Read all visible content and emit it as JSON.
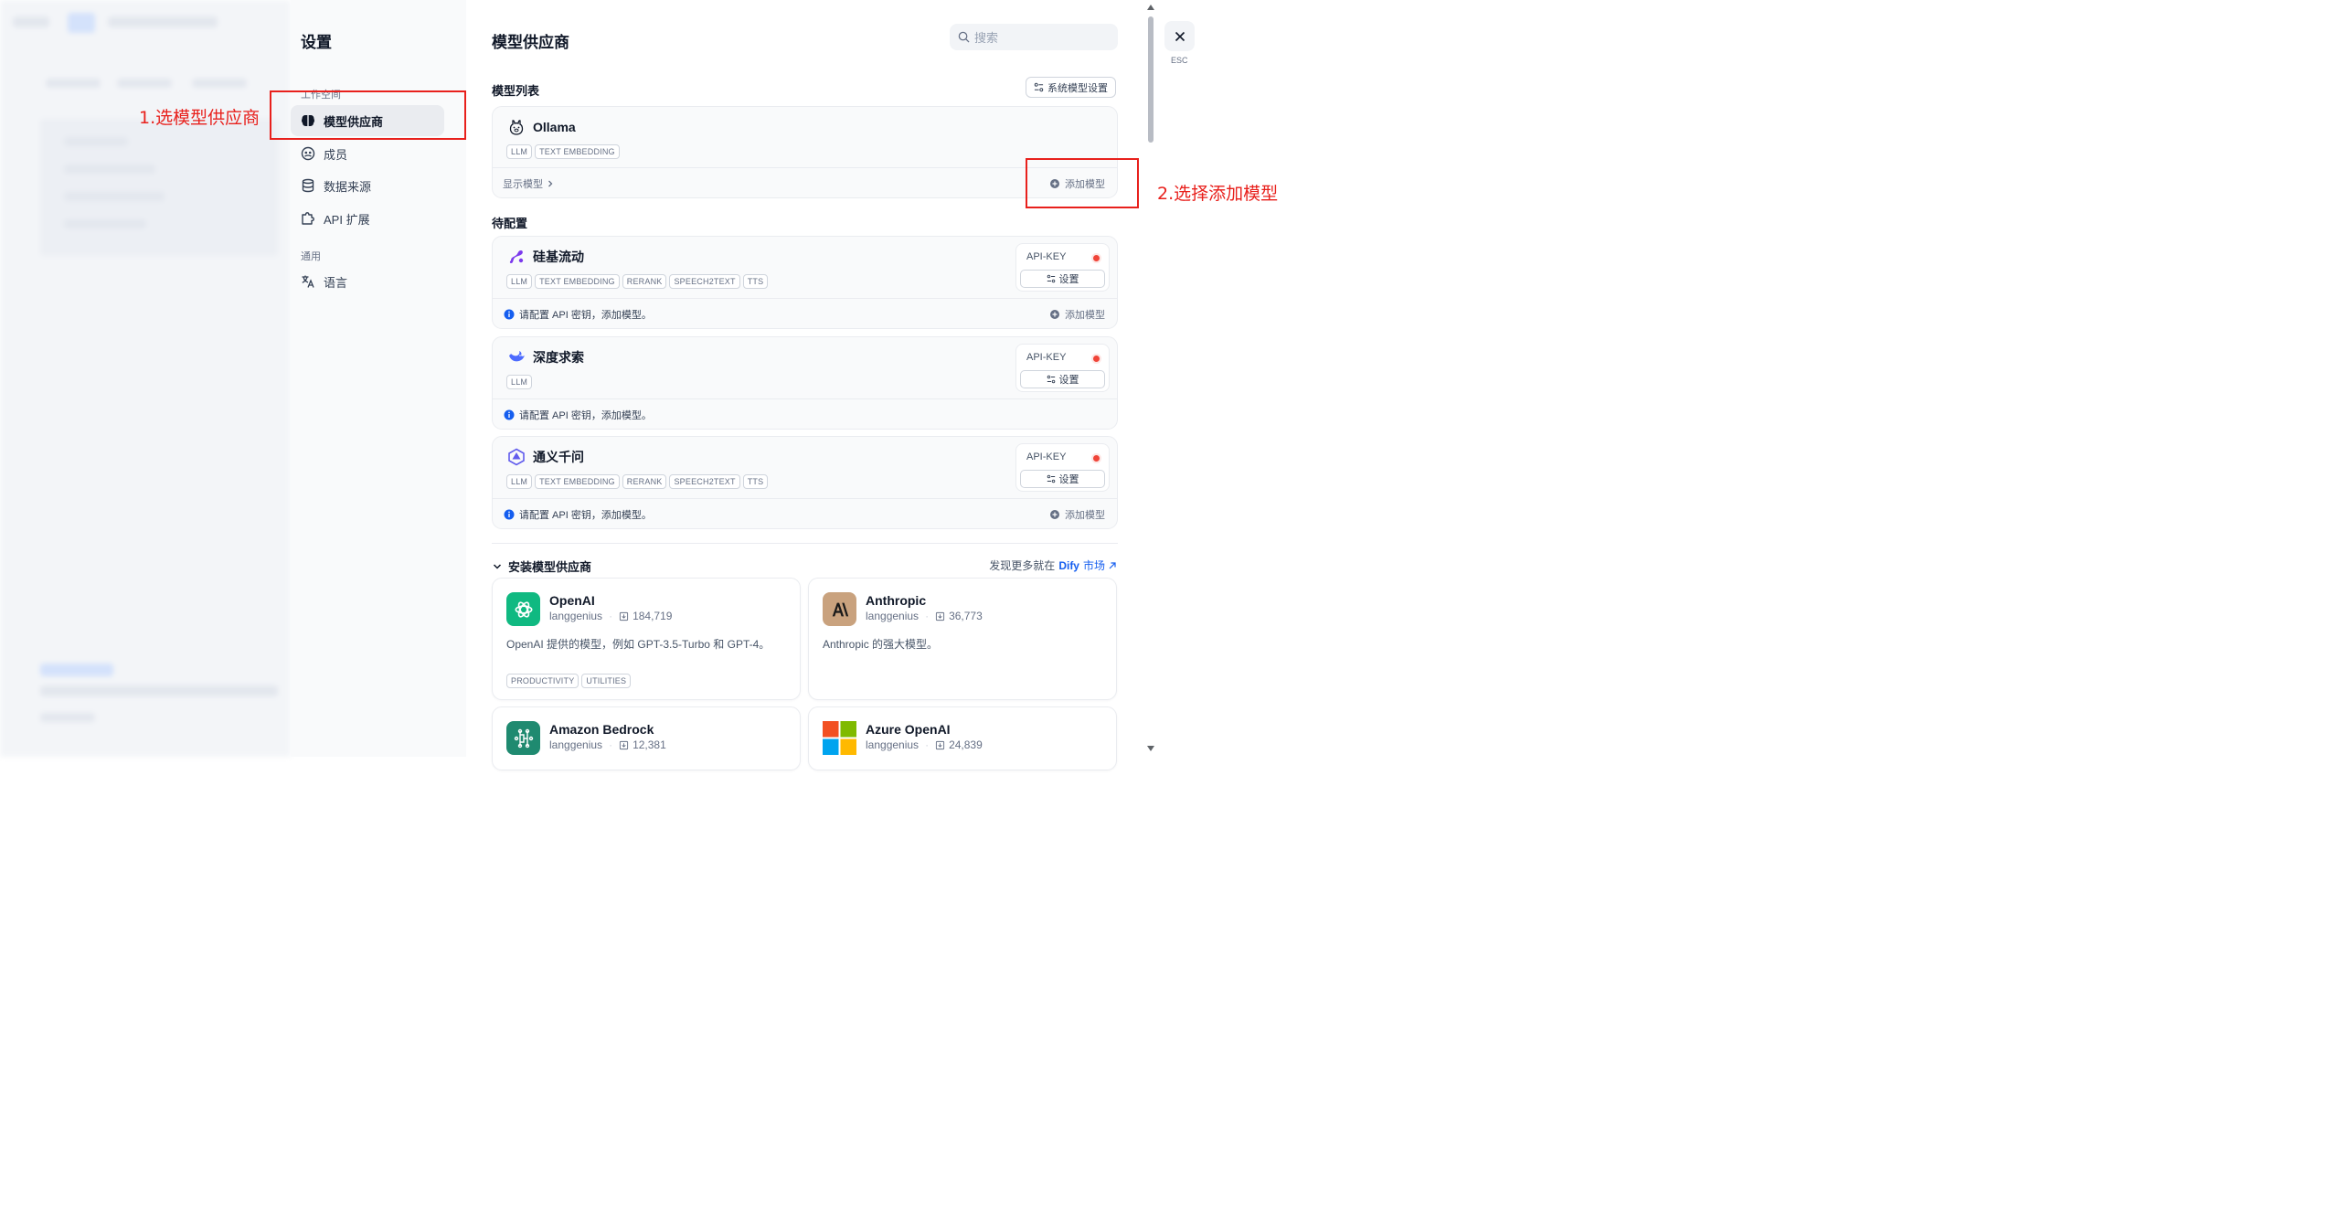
{
  "sidebar": {
    "title": "设置",
    "groups": [
      {
        "label": "工作空间"
      },
      {
        "label": "通用"
      }
    ],
    "items": [
      {
        "label": "模型供应商",
        "icon": "brain-icon",
        "active": true
      },
      {
        "label": "成员",
        "icon": "members-icon"
      },
      {
        "label": "数据来源",
        "icon": "database-icon"
      },
      {
        "label": "API 扩展",
        "icon": "puzzle-icon"
      },
      {
        "label": "语言",
        "icon": "translate-icon"
      }
    ]
  },
  "main": {
    "title": "模型供应商",
    "search_placeholder": "搜索",
    "model_list_label": "模型列表",
    "system_model_settings": "系统模型设置",
    "pending_label": "待配置",
    "ollama": {
      "name": "Ollama",
      "tags": [
        "LLM",
        "TEXT EMBEDDING"
      ],
      "show_models": "显示模型",
      "add_model": "添加模型"
    },
    "pending_providers": [
      {
        "name": "硅基流动",
        "icon": "siliconflow-icon",
        "tags": [
          "LLM",
          "TEXT EMBEDDING",
          "RERANK",
          "SPEECH2TEXT",
          "TTS"
        ],
        "apikey": "API-KEY",
        "setup": "设置",
        "info": "请配置 API 密钥，添加模型。",
        "add_model": "添加模型"
      },
      {
        "name": "深度求索",
        "icon": "deepseek-icon",
        "tags": [
          "LLM"
        ],
        "apikey": "API-KEY",
        "setup": "设置",
        "info": "请配置 API 密钥，添加模型。",
        "add_model": ""
      },
      {
        "name": "通义千问",
        "icon": "tongyi-icon",
        "tags": [
          "LLM",
          "TEXT EMBEDDING",
          "RERANK",
          "SPEECH2TEXT",
          "TTS"
        ],
        "apikey": "API-KEY",
        "setup": "设置",
        "info": "请配置 API 密钥，添加模型。",
        "add_model": "添加模型"
      }
    ],
    "install": {
      "title": "安装模型供应商",
      "discover_prefix": "发现更多就在",
      "dify": "Dify",
      "market": "市场"
    },
    "plugins": [
      {
        "name": "OpenAI",
        "author": "langgenius",
        "installs": "184,719",
        "desc": "OpenAI 提供的模型，例如 GPT-3.5-Turbo 和 GPT-4。",
        "tags": [
          "PRODUCTIVITY",
          "UTILITIES"
        ],
        "logo_color": "#10b981"
      },
      {
        "name": "Anthropic",
        "author": "langgenius",
        "installs": "36,773",
        "desc": "Anthropic 的强大模型。",
        "tags": [],
        "logo_color": "#c9a27e"
      },
      {
        "name": "Amazon Bedrock",
        "author": "langgenius",
        "installs": "12,381",
        "desc": "",
        "tags": [],
        "logo_color": "#1f8a70"
      },
      {
        "name": "Azure OpenAI",
        "author": "langgenius",
        "installs": "24,839",
        "desc": "",
        "tags": [],
        "logo_color": "#f25022"
      }
    ]
  },
  "esc_label": "ESC",
  "annotations": {
    "step1": "1.选模型供应商",
    "step2": "2.选择添加模型"
  },
  "colors": {
    "accent": "#155eef",
    "annotation": "#e8201c",
    "status_red": "#f04438"
  }
}
